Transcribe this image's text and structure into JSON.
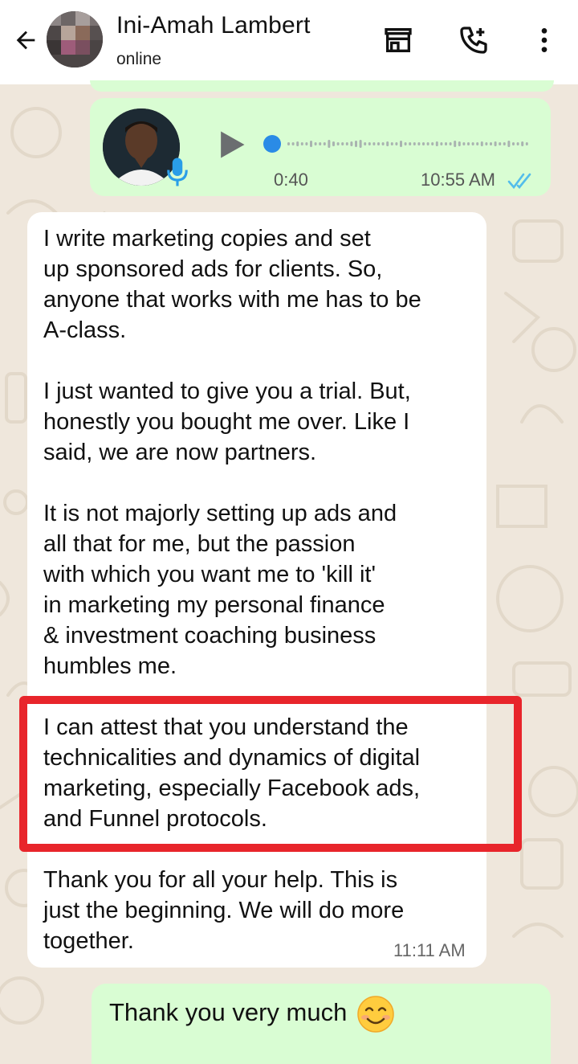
{
  "header": {
    "contact_name": "Ini-Amah Lambert",
    "status": "online",
    "icons": [
      "back-arrow-icon",
      "shop-icon",
      "add-call-icon",
      "more-vert-icon"
    ]
  },
  "voice_note": {
    "duration": "0:40",
    "time": "10:55 AM",
    "status": "read"
  },
  "incoming_message": {
    "paragraph_1": "I write marketing copies and set\nup sponsored ads for clients. So,\nanyone that works with me has to be\nA-class.",
    "paragraph_2": "I just wanted to give you a trial. But,\nhonestly you bought me over. Like I\nsaid, we are now partners.",
    "paragraph_3": "It is not majorly setting up ads and\nall that for me, but the passion\nwith which you want me to 'kill it'\nin marketing my personal finance\n& investment coaching business\nhumbles me.",
    "paragraph_4": "I can attest that you understand the\ntechnicalities and dynamics of digital\nmarketing, especially Facebook ads,\nand Funnel protocols.",
    "paragraph_5": "Thank you for all your help. This is\njust the beginning. We will do more\ntogether.",
    "time": "11:11 AM"
  },
  "outgoing_reply": {
    "text": "Thank you very much",
    "emoji": "smiling-face-emoji"
  },
  "colors": {
    "outgoing_bubble": "#d9fdd3",
    "incoming_bubble": "#ffffff",
    "wallpaper": "#efe7dc",
    "read_ticks": "#53bdeb",
    "highlight_border": "#e8252b"
  }
}
